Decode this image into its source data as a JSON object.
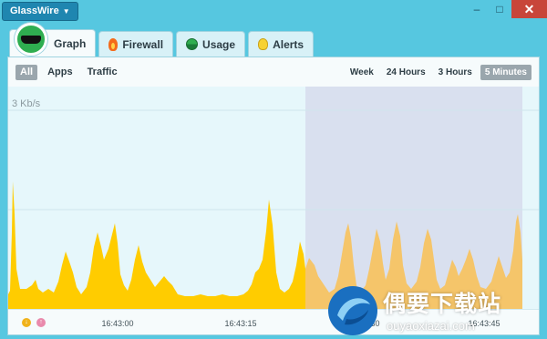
{
  "app": {
    "title": "GlassWire"
  },
  "window": {
    "minimize": "–",
    "maximize": "□",
    "close": "✕"
  },
  "tabs": [
    {
      "label": "Graph",
      "icon": "glasswire-logo-icon",
      "active": true
    },
    {
      "label": "Firewall",
      "icon": "flame-icon"
    },
    {
      "label": "Usage",
      "icon": "usage-icon"
    },
    {
      "label": "Alerts",
      "icon": "bulb-icon"
    }
  ],
  "filters": [
    "All",
    "Apps",
    "Traffic"
  ],
  "active_filter": "All",
  "ranges": [
    "Week",
    "24 Hours",
    "3 Hours",
    "5 Minutes"
  ],
  "active_range": "5 Minutes",
  "graph": {
    "scale_label": "3 Kb/s"
  },
  "timeline": {
    "ticks": [
      "16:43:00",
      "16:43:15",
      "16:43:30",
      "16:43:45"
    ]
  },
  "watermark": {
    "title": "偶要下载站",
    "url": "ouyaoxiazai.com"
  },
  "colors": {
    "accent": "#56c7e0",
    "graph_fill": "#ffcc00",
    "future_fill": "#f5c56a",
    "selection": "#d9e0ef"
  }
}
